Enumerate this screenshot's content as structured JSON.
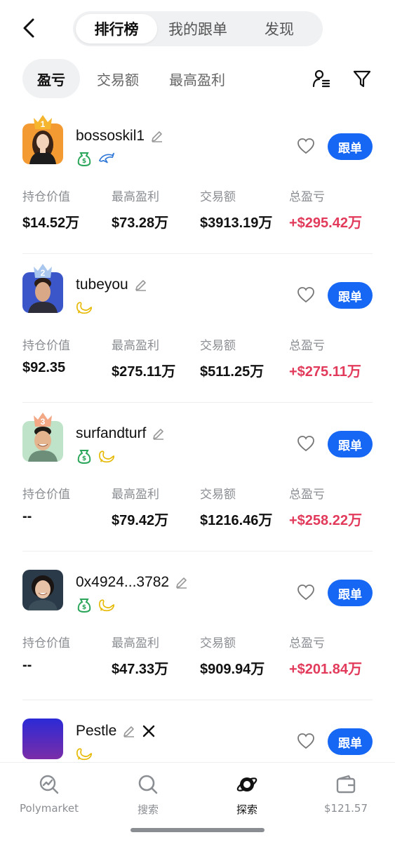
{
  "header": {
    "tabs": [
      {
        "label": "排行榜",
        "active": true
      },
      {
        "label": "我的跟单",
        "active": false
      },
      {
        "label": "发现",
        "active": false
      }
    ]
  },
  "filters": {
    "items": [
      {
        "label": "盈亏",
        "active": true
      },
      {
        "label": "交易额",
        "active": false
      },
      {
        "label": "最高盈利",
        "active": false
      }
    ]
  },
  "stat_labels": {
    "position": "持仓价值",
    "max_profit": "最高盈利",
    "volume": "交易额",
    "pnl": "总盈亏"
  },
  "follow_label": "跟单",
  "traders": [
    {
      "rank": "1",
      "name": "bossoskil1",
      "position": "$14.52万",
      "max_profit": "$73.28万",
      "volume": "$3913.19万",
      "pnl": "+$295.42万",
      "badges": [
        "money-bag-icon",
        "dolphin-icon"
      ]
    },
    {
      "rank": "2",
      "name": "tubeyou",
      "position": "$92.35",
      "max_profit": "$275.11万",
      "volume": "$511.25万",
      "pnl": "+$275.11万",
      "badges": [
        "whale-icon"
      ]
    },
    {
      "rank": "3",
      "name": "surfandturf",
      "position": "--",
      "max_profit": "$79.42万",
      "volume": "$1216.46万",
      "pnl": "+$258.22万",
      "badges": [
        "money-bag-icon",
        "whale-icon"
      ]
    },
    {
      "rank": "",
      "name": "0x4924...3782",
      "position": "--",
      "max_profit": "$47.33万",
      "volume": "$909.94万",
      "pnl": "+$201.84万",
      "badges": [
        "money-bag-icon",
        "whale-icon"
      ]
    },
    {
      "rank": "",
      "name": "Pestle",
      "badges": [
        "whale-icon"
      ],
      "has_x_link": true
    }
  ],
  "tabbar": {
    "items": [
      {
        "label": "Polymarket",
        "icon": "polymarket-icon",
        "active": false
      },
      {
        "label": "搜索",
        "icon": "search-icon",
        "active": false
      },
      {
        "label": "探索",
        "icon": "explore-icon",
        "active": true
      },
      {
        "label": "$121.57",
        "icon": "wallet-icon",
        "active": false
      }
    ]
  },
  "colors": {
    "accent": "#1767f5",
    "pnl_positive": "#e23a5b",
    "badge_green": "#2aa55a",
    "badge_yellow": "#e6b800",
    "badge_blue": "#2f78d8"
  }
}
